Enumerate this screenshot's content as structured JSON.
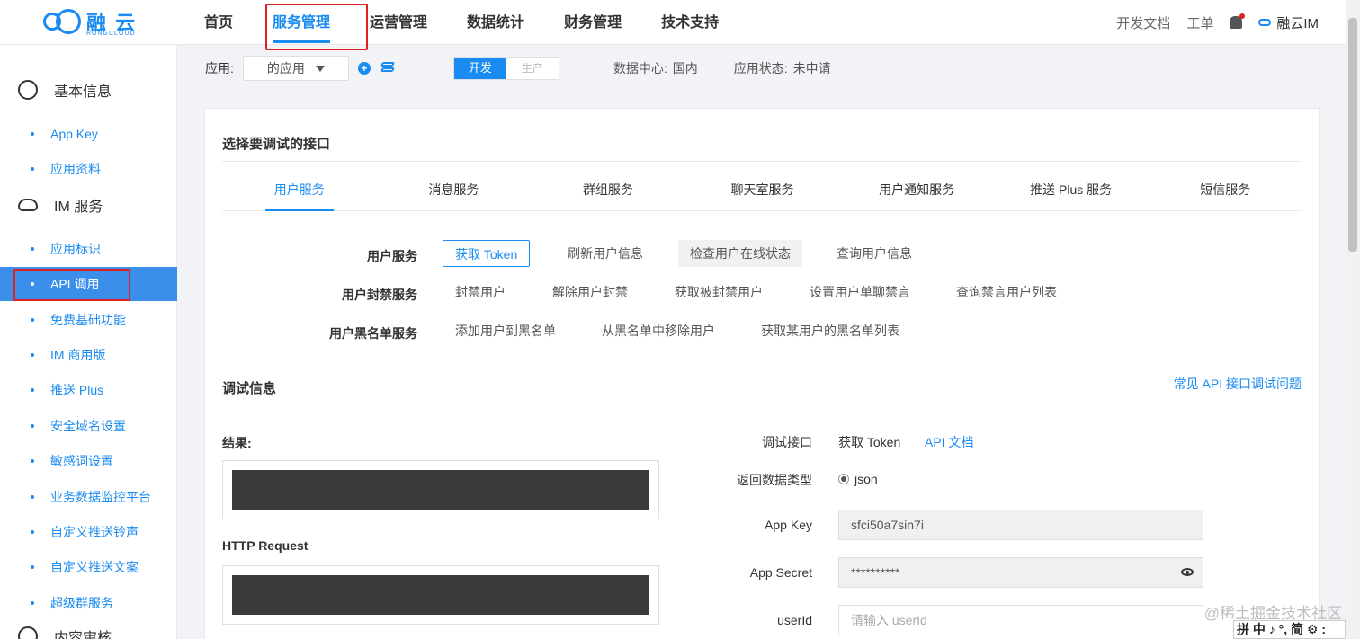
{
  "brand": {
    "name": "融 云",
    "sub": "RONGCLOUD"
  },
  "nav": {
    "items": [
      {
        "label": "首页",
        "active": false
      },
      {
        "label": "服务管理",
        "active": true
      },
      {
        "label": "运营管理",
        "active": false
      },
      {
        "label": "数据统计",
        "active": false
      },
      {
        "label": "财务管理",
        "active": false
      },
      {
        "label": "技术支持",
        "active": false
      }
    ],
    "right": {
      "docs": "开发文档",
      "ticket": "工单",
      "product": "融云IM"
    }
  },
  "sidebar": {
    "groups": {
      "basic": "基本信息",
      "im": "IM 服务",
      "content": "内容审核"
    },
    "basic_items": [
      "App Key",
      "应用资料"
    ],
    "im_items": [
      "应用标识",
      "API 调用",
      "免费基础功能",
      "IM 商用版",
      "推送 Plus",
      "安全域名设置",
      "敏感词设置",
      "业务数据监控平台",
      "自定义推送铃声",
      "自定义推送文案",
      "超级群服务"
    ],
    "active": "API 调用"
  },
  "toolbar": {
    "app_label": "应用:",
    "app_value": "的应用",
    "env_dev": "开发",
    "env_prod": "生产",
    "datacenter_label": "数据中心:",
    "datacenter_value": "国内",
    "status_label": "应用状态:",
    "status_value": "未申请"
  },
  "api": {
    "title": "选择要调试的接口",
    "tabs": [
      "用户服务",
      "消息服务",
      "群组服务",
      "聊天室服务",
      "用户通知服务",
      "推送 Plus 服务",
      "短信服务"
    ],
    "active_tab": "用户服务",
    "rows": [
      {
        "label": "用户服务",
        "ops": [
          "获取 Token",
          "刷新用户信息",
          "检查用户在线状态",
          "查询用户信息"
        ]
      },
      {
        "label": "用户封禁服务",
        "ops": [
          "封禁用户",
          "解除用户封禁",
          "获取被封禁用户",
          "设置用户单聊禁言",
          "查询禁言用户列表"
        ]
      },
      {
        "label": "用户黑名单服务",
        "ops": [
          "添加用户到黑名单",
          "从黑名单中移除用户",
          "获取某用户的黑名单列表"
        ]
      }
    ]
  },
  "debug": {
    "title": "调试信息",
    "help_link": "常见 API 接口调试问题",
    "result_label": "结果:",
    "http_label": "HTTP Request",
    "form": {
      "endpoint_label": "调试接口",
      "endpoint_value": "获取 Token",
      "doc_link": "API 文档",
      "type_label": "返回数据类型",
      "type_value": "json",
      "appkey_label": "App Key",
      "appkey_value": "sfci50a7sin7i",
      "secret_label": "App Secret",
      "secret_value": "**********",
      "userid_label": "userId",
      "userid_placeholder": "请输入 userId"
    }
  },
  "watermark": "@稀土掘金技术社区",
  "ime": "拼 中 ♪ °, 简 ⚙ :"
}
